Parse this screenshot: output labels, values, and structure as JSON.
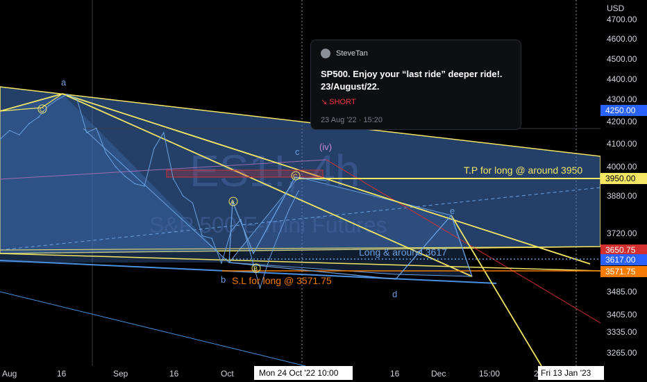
{
  "chart_data": {
    "type": "line",
    "symbol": "ES1!, 4h",
    "name": "S&P 500 E-mini Futures",
    "currency": "USD",
    "y_ticks": [
      "4700.00",
      "4600.00",
      "4500.00",
      "4400.00",
      "4300.00",
      "4200.00",
      "4100.00",
      "4000.00",
      "3880.00",
      "3720.00",
      "3485.00",
      "3405.00",
      "3335.00",
      "3265.00"
    ],
    "x_ticks": [
      "Aug",
      "16",
      "Sep",
      "16",
      "Oct",
      "16",
      "Dec",
      "15:00",
      "2"
    ],
    "crosshair_x_label": "Mon 24 Oct '22   10:00",
    "crosshair_end_label": "Fri 13 Jan '23",
    "price_labels": [
      {
        "value": "4250.00",
        "color": "#2962ff"
      },
      {
        "value": "3950.00",
        "color": "#f5e663"
      },
      {
        "value": "3650.75",
        "color": "#d32f2f"
      },
      {
        "value": "3617.00",
        "color": "#2962ff"
      },
      {
        "value": "3571.75",
        "color": "#f57c00"
      }
    ],
    "wave_labels": {
      "a": "a",
      "b": "b",
      "c": "c",
      "d": "d",
      "e": "e",
      "iv": "(iv)",
      "A": "A",
      "B": "B",
      "C": "C"
    },
    "annotations": {
      "tp": "T.P for long @ around 3950",
      "long": "Long & around 3617",
      "sl": "S.L for long @ 3571.75"
    },
    "price_series": [
      [
        "Aug 1",
        4120
      ],
      [
        "Aug 3",
        4160
      ],
      [
        "Aug 5",
        4140
      ],
      [
        "Aug 8",
        4190
      ],
      [
        "Aug 10",
        4220
      ],
      [
        "Aug 12",
        4270
      ],
      [
        "Aug 15",
        4300
      ],
      [
        "Aug 16",
        4325
      ],
      [
        "Aug 18",
        4300
      ],
      [
        "Aug 22",
        4150
      ],
      [
        "Aug 24",
        4170
      ],
      [
        "Aug 26",
        4060
      ],
      [
        "Aug 30",
        4000
      ],
      [
        "Sep 1",
        3960
      ],
      [
        "Sep 2",
        3930
      ],
      [
        "Sep 6",
        3920
      ],
      [
        "Sep 9",
        4080
      ],
      [
        "Sep 12",
        4150
      ],
      [
        "Sep 13",
        3950
      ],
      [
        "Sep 16",
        3880
      ],
      [
        "Sep 20",
        3850
      ],
      [
        "Sep 23",
        3710
      ],
      [
        "Sep 27",
        3700
      ],
      [
        "Sep 30",
        3600
      ],
      [
        "Oct 4",
        3730
      ],
      [
        "Oct 6",
        3780
      ],
      [
        "Oct 10",
        3640
      ],
      [
        "Oct 13",
        3500
      ],
      [
        "Oct 14",
        3620
      ],
      [
        "Oct 18",
        3720
      ],
      [
        "Oct 21",
        3820
      ],
      [
        "Oct 24",
        3900
      ]
    ]
  },
  "idea": {
    "author": "SteveTan",
    "title_line1": "SP500. Enjoy your “last ride” deeper ride!.",
    "title_line2": "23/August/22.",
    "direction": "↘ SHORT",
    "date": "23 Aug '22 · 15:20"
  }
}
